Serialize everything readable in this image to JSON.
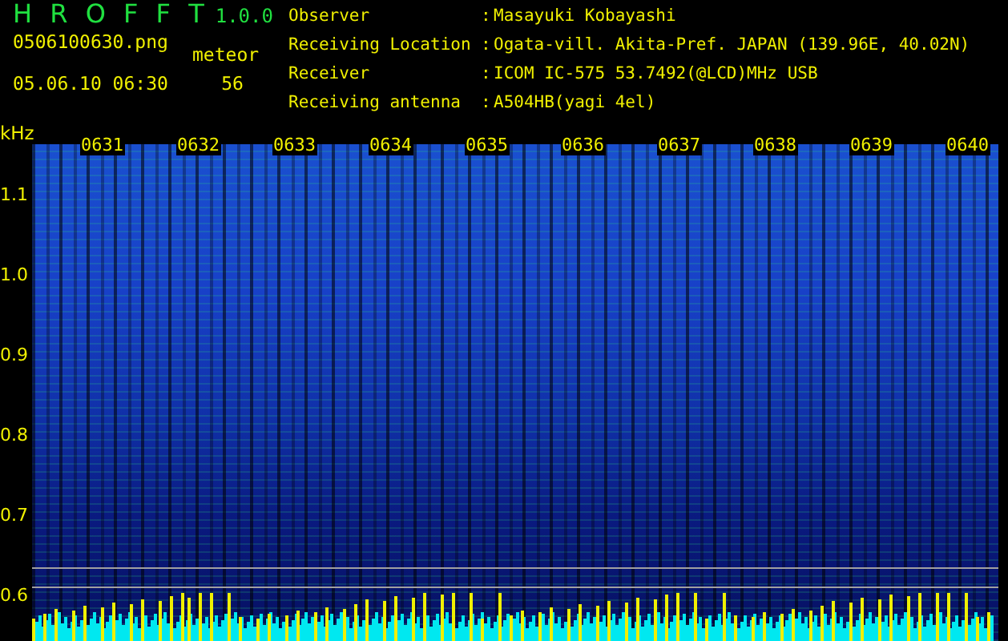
{
  "app": {
    "name": "H R O F F T",
    "version": "1.0.0"
  },
  "file": {
    "name": "0506100630.png",
    "datetime": "05.06.10 06:30"
  },
  "meteor": {
    "label": "meteor",
    "count": "56"
  },
  "info": [
    {
      "label": "Observer",
      "value": "Masayuki Kobayashi"
    },
    {
      "label": "Receiving Location",
      "value": "Ogata-vill. Akita-Pref. JAPAN (139.96E, 40.02N)"
    },
    {
      "label": "Receiver",
      "value": "ICOM IC-575 53.7492(@LCD)MHz USB"
    },
    {
      "label": "Receiving antenna",
      "value": "A504HB(yagi 4el)"
    }
  ],
  "separator": ":",
  "spectrogram": {
    "unit": "kHz",
    "time_labels": [
      "0631",
      "0632",
      "0633",
      "0634",
      "0635",
      "0636",
      "0637",
      "0638",
      "0639",
      "0640"
    ],
    "frequency_labels": [
      "1.1",
      "1.0",
      "0.9",
      "0.8",
      "0.7",
      "0.6"
    ]
  }
}
